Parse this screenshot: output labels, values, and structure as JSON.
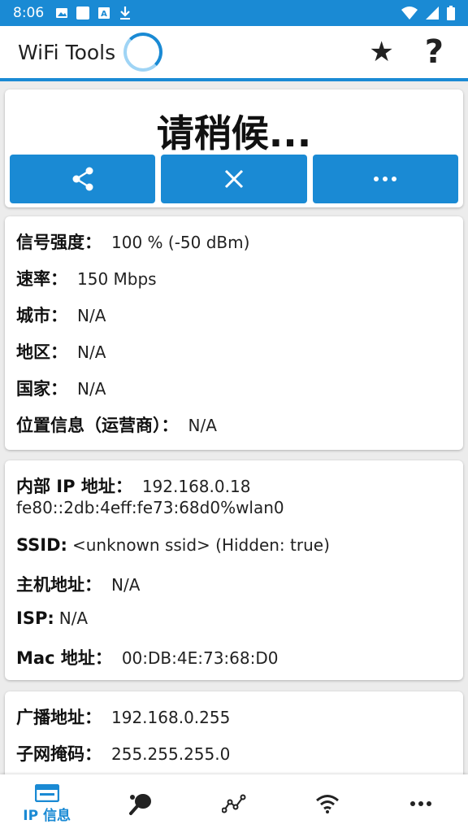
{
  "status_bar": {
    "time": "8:06"
  },
  "app_bar": {
    "title": "WiFi Tools"
  },
  "status_card": {
    "heading": "请稍候...",
    "buttons": [
      "share",
      "close",
      "more"
    ]
  },
  "signal_card": {
    "rows": [
      {
        "label": "信号强度：",
        "value": "100 % (-50 dBm)"
      },
      {
        "label": "速率：",
        "value": "150 Mbps"
      },
      {
        "label": "城市：",
        "value": "N/A"
      },
      {
        "label": "地区：",
        "value": "N/A"
      },
      {
        "label": "国家：",
        "value": "N/A"
      },
      {
        "label": "位置信息（运营商）：",
        "value": "N/A"
      }
    ]
  },
  "network_card": {
    "internal_ip_label": "内部 IP 地址：",
    "internal_ip_v4": "192.168.0.18",
    "internal_ip_v6": "fe80::2db:4eff:fe73:68d0%wlan0",
    "ssid_label": "SSID:",
    "ssid_value": "<unknown ssid> (Hidden: true)",
    "host_label": "主机地址：",
    "host_value": "N/A",
    "isp_label": "ISP:",
    "isp_value": "N/A",
    "mac_label": "Mac 地址：",
    "mac_value": "00:DB:4E:73:68:D0"
  },
  "broadcast_card": {
    "broadcast_label": "广播地址：",
    "broadcast_value": "192.168.0.255",
    "mask_label": "子网掩码：",
    "mask_value": "255.255.255.0"
  },
  "bottom_nav": {
    "items": [
      {
        "icon": "ip-info-icon",
        "label": "IP 信息",
        "active": true
      },
      {
        "icon": "ping-pong-icon"
      },
      {
        "icon": "graph-icon"
      },
      {
        "icon": "wifi-icon"
      },
      {
        "icon": "more-icon"
      }
    ]
  },
  "colors": {
    "accent": "#1a8ad4",
    "background": "#ececec"
  }
}
